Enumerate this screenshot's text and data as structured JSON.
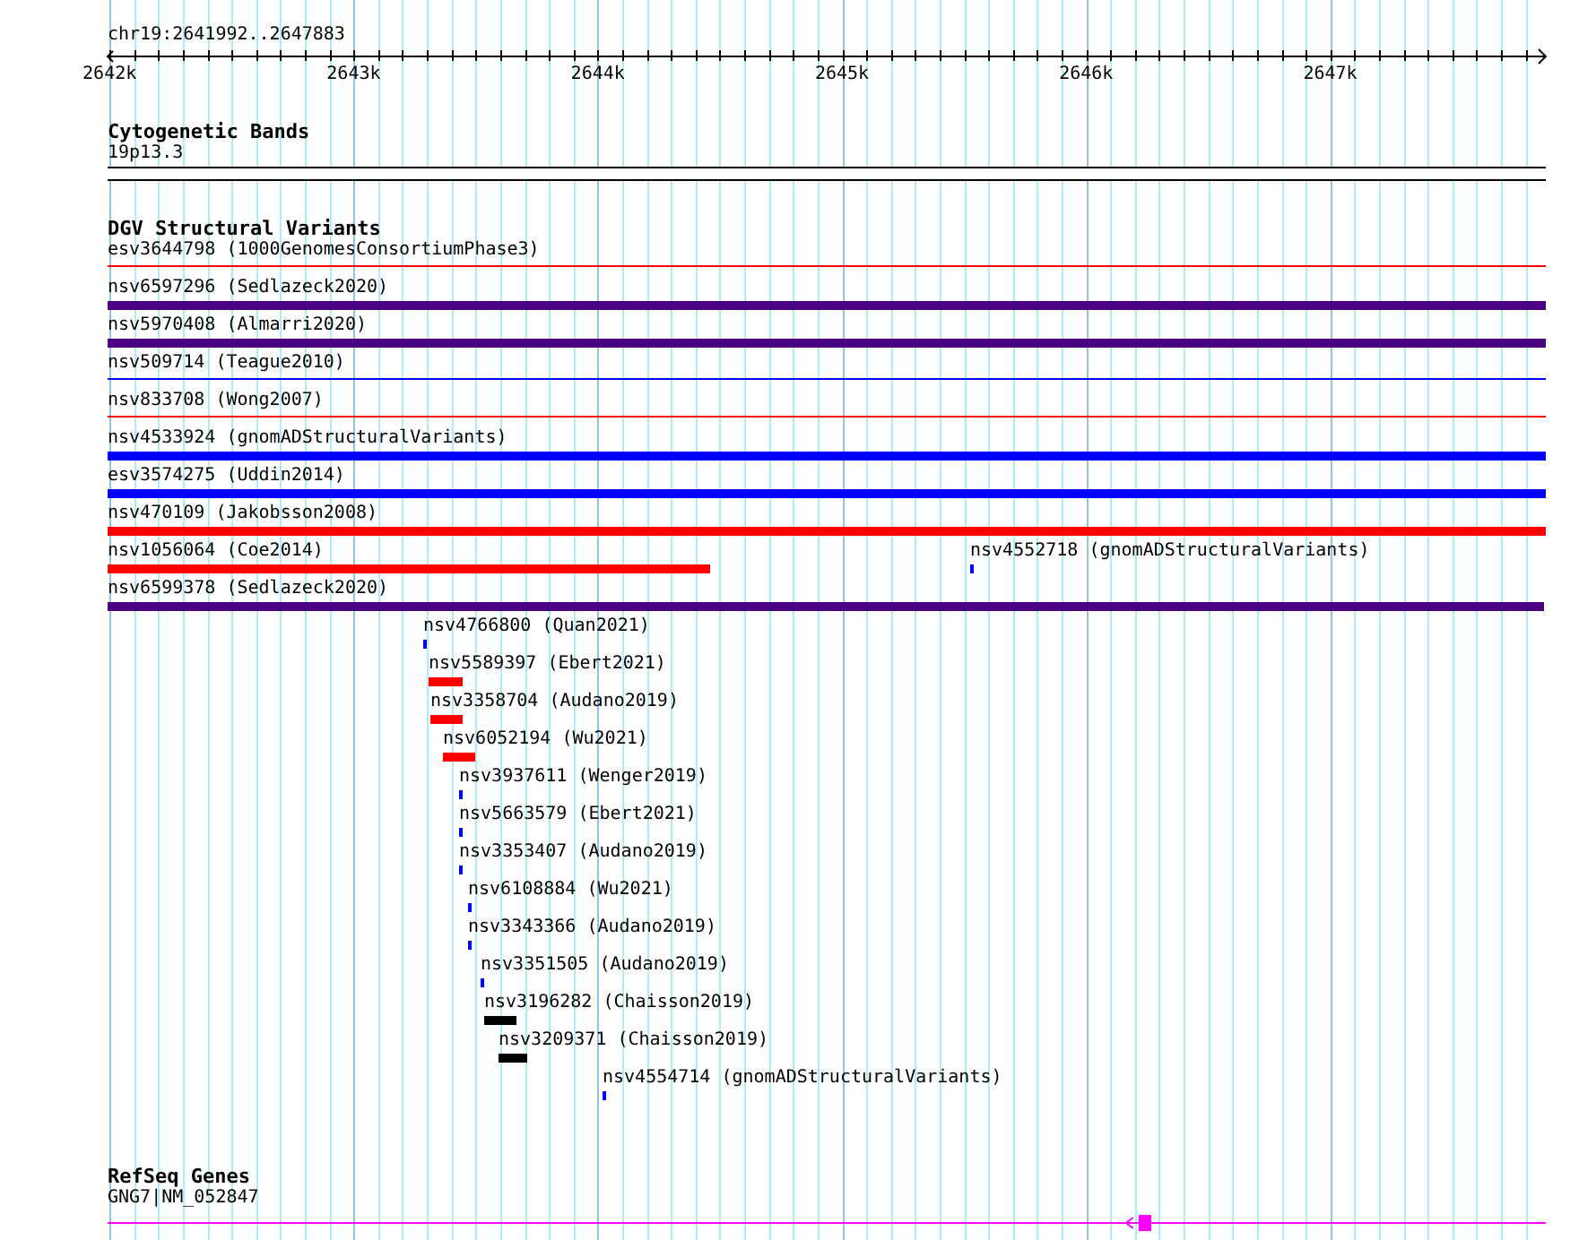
{
  "ruler": {
    "title": "chr19:2641992..2647883",
    "ticks": [
      "2642k",
      "2643k",
      "2644k",
      "2645k",
      "2646k",
      "2647k"
    ]
  },
  "cytogenetic_bands": {
    "title": "Cytogenetic Bands",
    "band": {
      "label": "19p13.3"
    }
  },
  "dgv_structural_variants": {
    "title": "DGV Structural Variants",
    "rows": [
      {
        "features": [
          {
            "label": "esv3644798 (1000GenomesConsortiumPhase3)",
            "kind": "thin",
            "color": "#ff0000"
          }
        ]
      },
      {
        "features": [
          {
            "label": "nsv6597296 (Sedlazeck2020)",
            "kind": "thick",
            "color": "#4b0082"
          }
        ]
      },
      {
        "features": [
          {
            "label": "nsv5970408 (Almarri2020)",
            "kind": "thick",
            "color": "#4b0082"
          }
        ]
      },
      {
        "features": [
          {
            "label": "nsv509714 (Teague2010)",
            "kind": "thin",
            "color": "#0000ff"
          }
        ]
      },
      {
        "features": [
          {
            "label": "nsv833708 (Wong2007)",
            "kind": "thin",
            "color": "#ff0000"
          }
        ]
      },
      {
        "features": [
          {
            "label": "nsv4533924 (gnomADStructuralVariants)",
            "kind": "thick",
            "color": "#0000ff"
          }
        ]
      },
      {
        "features": [
          {
            "label": "esv3574275 (Uddin2014)",
            "kind": "thick",
            "color": "#0000ff"
          }
        ]
      },
      {
        "features": [
          {
            "label": "nsv470109 (Jakobsson2008)",
            "kind": "thick",
            "color": "#ff0000"
          }
        ]
      },
      {
        "features": [
          {
            "label": "nsv1056064 (Coe2014)",
            "kind": "thick",
            "color": "#ff0000"
          },
          {
            "label": "nsv4552718 (gnomADStructuralVariants)",
            "kind": "thick",
            "color": "#0000ff"
          }
        ]
      },
      {
        "features": [
          {
            "label": "nsv6599378 (Sedlazeck2020)",
            "kind": "thick",
            "color": "#4b0082"
          }
        ]
      },
      {
        "features": [
          {
            "label": "nsv4766800 (Quan2021)",
            "kind": "thick",
            "color": "#0000ff"
          }
        ]
      },
      {
        "features": [
          {
            "label": "nsv5589397 (Ebert2021)",
            "kind": "thick",
            "color": "#ff0000"
          }
        ]
      },
      {
        "features": [
          {
            "label": "nsv3358704 (Audano2019)",
            "kind": "thick",
            "color": "#ff0000"
          }
        ]
      },
      {
        "features": [
          {
            "label": "nsv6052194 (Wu2021)",
            "kind": "thick",
            "color": "#ff0000"
          }
        ]
      },
      {
        "features": [
          {
            "label": "nsv3937611 (Wenger2019)",
            "kind": "thick",
            "color": "#0000ff"
          }
        ]
      },
      {
        "features": [
          {
            "label": "nsv5663579 (Ebert2021)",
            "kind": "thick",
            "color": "#0000ff"
          }
        ]
      },
      {
        "features": [
          {
            "label": "nsv3353407 (Audano2019)",
            "kind": "thick",
            "color": "#0000ff"
          }
        ]
      },
      {
        "features": [
          {
            "label": "nsv6108884 (Wu2021)",
            "kind": "thick",
            "color": "#0000ff"
          }
        ]
      },
      {
        "features": [
          {
            "label": "nsv3343366 (Audano2019)",
            "kind": "thick",
            "color": "#0000ff"
          }
        ]
      },
      {
        "features": [
          {
            "label": "nsv3351505 (Audano2019)",
            "kind": "thick",
            "color": "#0000ff"
          }
        ]
      },
      {
        "features": [
          {
            "label": "nsv3196282 (Chaisson2019)",
            "kind": "thick",
            "color": "#000000"
          }
        ]
      },
      {
        "features": [
          {
            "label": "nsv3209371 (Chaisson2019)",
            "kind": "thick",
            "color": "#000000"
          }
        ]
      },
      {
        "features": [
          {
            "label": "nsv4554714 (gnomADStructuralVariants)",
            "kind": "thick",
            "color": "#0000ff"
          }
        ]
      }
    ]
  },
  "refseq_genes": {
    "title": "RefSeq Genes",
    "genes": [
      {
        "label": "GNG7|NM_052847",
        "color": "#ff00ff"
      }
    ]
  }
}
